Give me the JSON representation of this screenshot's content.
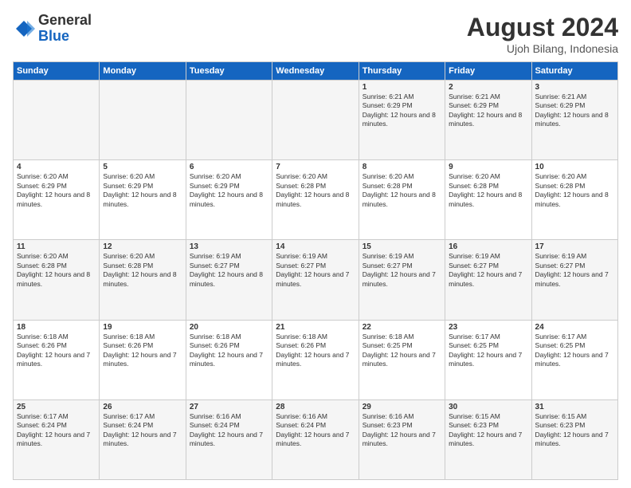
{
  "header": {
    "logo_general": "General",
    "logo_blue": "Blue",
    "title": "August 2024",
    "location": "Ujoh Bilang, Indonesia"
  },
  "weekdays": [
    "Sunday",
    "Monday",
    "Tuesday",
    "Wednesday",
    "Thursday",
    "Friday",
    "Saturday"
  ],
  "weeks": [
    [
      {
        "day": "",
        "info": ""
      },
      {
        "day": "",
        "info": ""
      },
      {
        "day": "",
        "info": ""
      },
      {
        "day": "",
        "info": ""
      },
      {
        "day": "1",
        "info": "Sunrise: 6:21 AM\nSunset: 6:29 PM\nDaylight: 12 hours and 8 minutes."
      },
      {
        "day": "2",
        "info": "Sunrise: 6:21 AM\nSunset: 6:29 PM\nDaylight: 12 hours and 8 minutes."
      },
      {
        "day": "3",
        "info": "Sunrise: 6:21 AM\nSunset: 6:29 PM\nDaylight: 12 hours and 8 minutes."
      }
    ],
    [
      {
        "day": "4",
        "info": "Sunrise: 6:20 AM\nSunset: 6:29 PM\nDaylight: 12 hours and 8 minutes."
      },
      {
        "day": "5",
        "info": "Sunrise: 6:20 AM\nSunset: 6:29 PM\nDaylight: 12 hours and 8 minutes."
      },
      {
        "day": "6",
        "info": "Sunrise: 6:20 AM\nSunset: 6:29 PM\nDaylight: 12 hours and 8 minutes."
      },
      {
        "day": "7",
        "info": "Sunrise: 6:20 AM\nSunset: 6:28 PM\nDaylight: 12 hours and 8 minutes."
      },
      {
        "day": "8",
        "info": "Sunrise: 6:20 AM\nSunset: 6:28 PM\nDaylight: 12 hours and 8 minutes."
      },
      {
        "day": "9",
        "info": "Sunrise: 6:20 AM\nSunset: 6:28 PM\nDaylight: 12 hours and 8 minutes."
      },
      {
        "day": "10",
        "info": "Sunrise: 6:20 AM\nSunset: 6:28 PM\nDaylight: 12 hours and 8 minutes."
      }
    ],
    [
      {
        "day": "11",
        "info": "Sunrise: 6:20 AM\nSunset: 6:28 PM\nDaylight: 12 hours and 8 minutes."
      },
      {
        "day": "12",
        "info": "Sunrise: 6:20 AM\nSunset: 6:28 PM\nDaylight: 12 hours and 8 minutes."
      },
      {
        "day": "13",
        "info": "Sunrise: 6:19 AM\nSunset: 6:27 PM\nDaylight: 12 hours and 8 minutes."
      },
      {
        "day": "14",
        "info": "Sunrise: 6:19 AM\nSunset: 6:27 PM\nDaylight: 12 hours and 7 minutes."
      },
      {
        "day": "15",
        "info": "Sunrise: 6:19 AM\nSunset: 6:27 PM\nDaylight: 12 hours and 7 minutes."
      },
      {
        "day": "16",
        "info": "Sunrise: 6:19 AM\nSunset: 6:27 PM\nDaylight: 12 hours and 7 minutes."
      },
      {
        "day": "17",
        "info": "Sunrise: 6:19 AM\nSunset: 6:27 PM\nDaylight: 12 hours and 7 minutes."
      }
    ],
    [
      {
        "day": "18",
        "info": "Sunrise: 6:18 AM\nSunset: 6:26 PM\nDaylight: 12 hours and 7 minutes."
      },
      {
        "day": "19",
        "info": "Sunrise: 6:18 AM\nSunset: 6:26 PM\nDaylight: 12 hours and 7 minutes."
      },
      {
        "day": "20",
        "info": "Sunrise: 6:18 AM\nSunset: 6:26 PM\nDaylight: 12 hours and 7 minutes."
      },
      {
        "day": "21",
        "info": "Sunrise: 6:18 AM\nSunset: 6:26 PM\nDaylight: 12 hours and 7 minutes."
      },
      {
        "day": "22",
        "info": "Sunrise: 6:18 AM\nSunset: 6:25 PM\nDaylight: 12 hours and 7 minutes."
      },
      {
        "day": "23",
        "info": "Sunrise: 6:17 AM\nSunset: 6:25 PM\nDaylight: 12 hours and 7 minutes."
      },
      {
        "day": "24",
        "info": "Sunrise: 6:17 AM\nSunset: 6:25 PM\nDaylight: 12 hours and 7 minutes."
      }
    ],
    [
      {
        "day": "25",
        "info": "Sunrise: 6:17 AM\nSunset: 6:24 PM\nDaylight: 12 hours and 7 minutes."
      },
      {
        "day": "26",
        "info": "Sunrise: 6:17 AM\nSunset: 6:24 PM\nDaylight: 12 hours and 7 minutes."
      },
      {
        "day": "27",
        "info": "Sunrise: 6:16 AM\nSunset: 6:24 PM\nDaylight: 12 hours and 7 minutes."
      },
      {
        "day": "28",
        "info": "Sunrise: 6:16 AM\nSunset: 6:24 PM\nDaylight: 12 hours and 7 minutes."
      },
      {
        "day": "29",
        "info": "Sunrise: 6:16 AM\nSunset: 6:23 PM\nDaylight: 12 hours and 7 minutes."
      },
      {
        "day": "30",
        "info": "Sunrise: 6:15 AM\nSunset: 6:23 PM\nDaylight: 12 hours and 7 minutes."
      },
      {
        "day": "31",
        "info": "Sunrise: 6:15 AM\nSunset: 6:23 PM\nDaylight: 12 hours and 7 minutes."
      }
    ]
  ]
}
